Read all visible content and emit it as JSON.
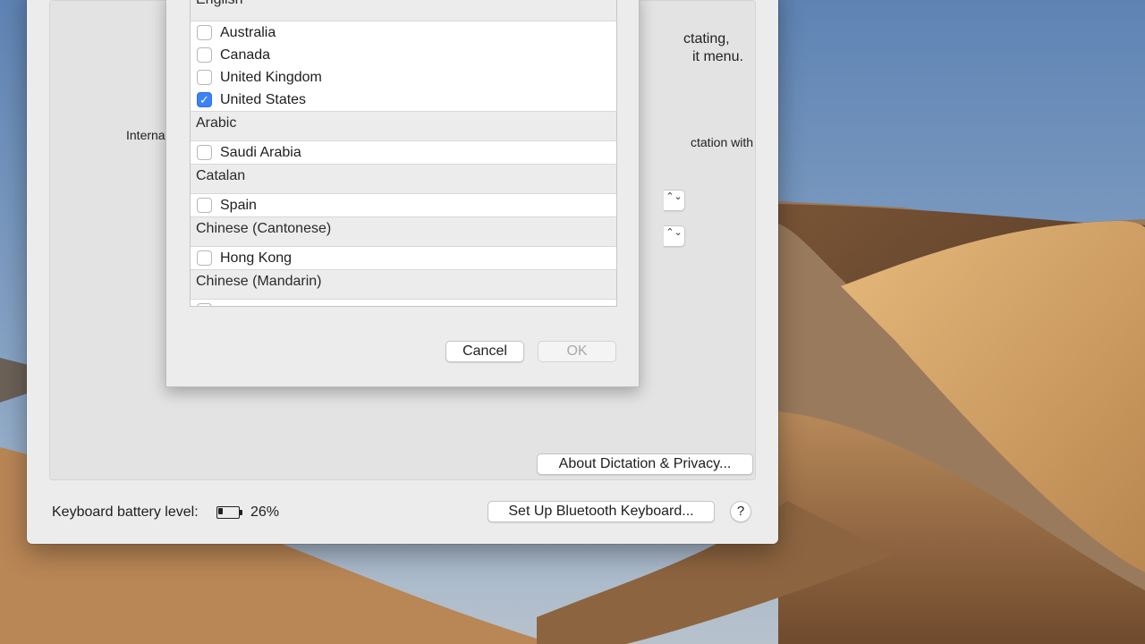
{
  "colors": {
    "accent": "#3b82f6",
    "sky": "#6f8fb6",
    "dune": "#c49358",
    "window": "#ececec"
  },
  "background": {
    "description_icon": "mojave-dunes-wallpaper"
  },
  "dictation_panel": {
    "mic_icon": "microphone-icon",
    "mic_label": "Internal Mi",
    "desc_line_1": "ctating,",
    "desc_line_2": "it menu.",
    "desc_line_3": "ctation with",
    "popup_arrows": "⌃⌄",
    "about_button": "About Dictation & Privacy..."
  },
  "footer": {
    "battery_label": "Keyboard battery level:",
    "battery_icon": "battery-icon",
    "battery_level": 0.26,
    "battery_value": "26%",
    "setup_button": "Set Up Bluetooth Keyboard...",
    "help_button": "?"
  },
  "language_sheet": {
    "groups": [
      {
        "name": "English",
        "items": [
          {
            "label": "Australia",
            "checked": false
          },
          {
            "label": "Canada",
            "checked": false
          },
          {
            "label": "United Kingdom",
            "checked": false
          },
          {
            "label": "United States",
            "checked": true
          }
        ]
      },
      {
        "name": "Arabic",
        "items": [
          {
            "label": "Saudi Arabia",
            "checked": false
          }
        ]
      },
      {
        "name": "Catalan",
        "items": [
          {
            "label": "Spain",
            "checked": false
          }
        ]
      },
      {
        "name": "Chinese (Cantonese)",
        "items": [
          {
            "label": "Hong Kong",
            "checked": false
          }
        ]
      },
      {
        "name": "Chinese (Mandarin)",
        "items": [
          {
            "label": "",
            "checked": false
          }
        ]
      }
    ],
    "checkmark": "✓",
    "cancel_button": "Cancel",
    "ok_button": "OK"
  }
}
